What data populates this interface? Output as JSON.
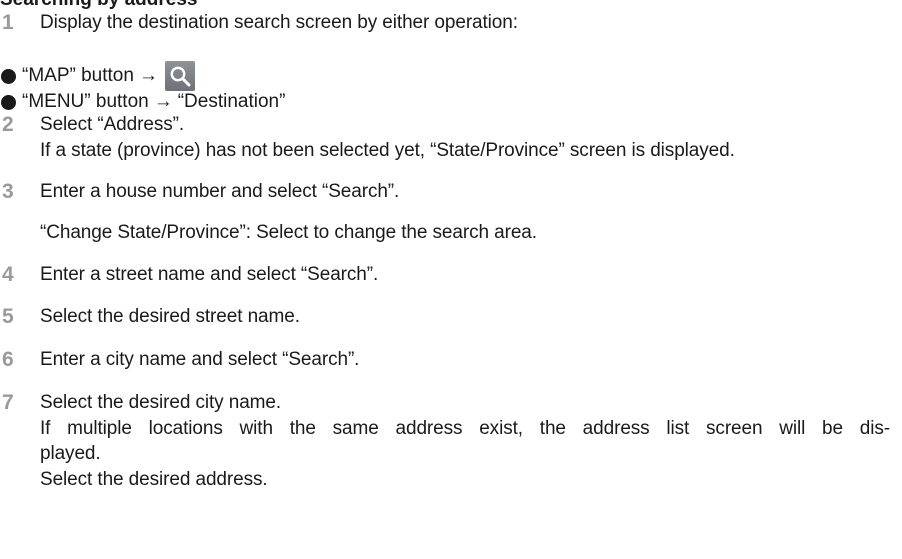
{
  "clipped_heading": "Searching by address",
  "steps": [
    {
      "num": "1",
      "text": "Display the destination search screen by either operation:"
    },
    {
      "num": "2",
      "text": "Select “Address”."
    },
    {
      "num": "3",
      "text": "Enter a house number and select “Search”."
    },
    {
      "num": "4",
      "text": "Enter a street name and select “Search”."
    },
    {
      "num": "5",
      "text": "Select the desired street name."
    },
    {
      "num": "6",
      "text": "Enter a city name and select “Search”."
    },
    {
      "num": "7",
      "text": "Select the desired city name."
    }
  ],
  "bullets": [
    {
      "prefix": "“MAP” button",
      "arrow": "→",
      "icon": "search-icon"
    },
    {
      "prefix": "“MENU” button",
      "arrow": "→",
      "suffix": "“Destination”"
    }
  ],
  "notes": {
    "step2": "If a state (province) has not been selected yet, “State/Province” screen is displayed.",
    "step3": "“Change State/Province”: Select to change the search area.",
    "step7_line1": "If multiple locations with the same address exist, the address list screen will be dis-",
    "step7_line2": "played.",
    "step7_line3": "Select the desired address."
  },
  "colors": {
    "step_number": "#9a9a9a",
    "text": "#1a1a1a",
    "search_button": "#7d8187"
  }
}
